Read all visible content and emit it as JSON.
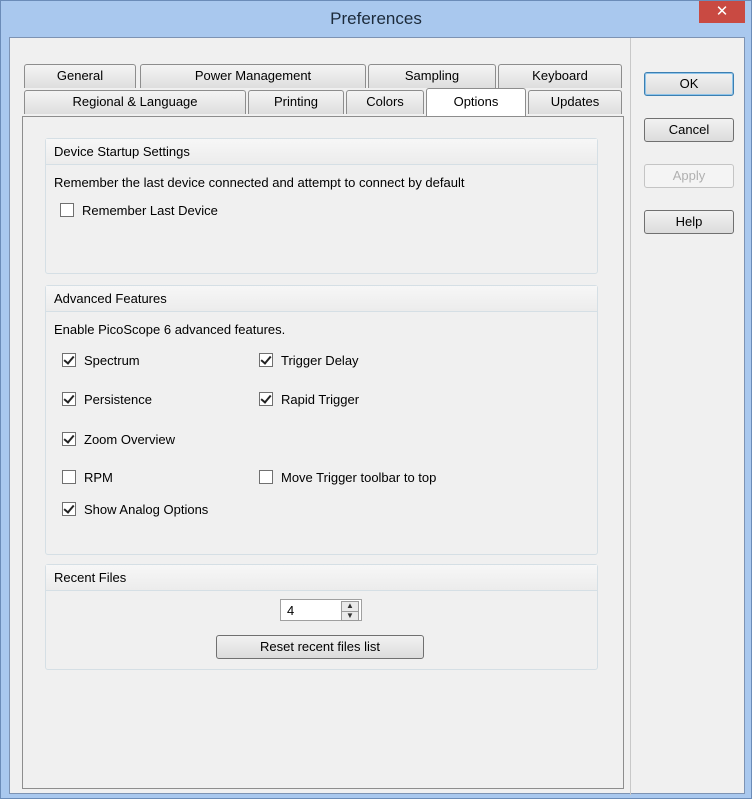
{
  "window": {
    "title": "Preferences",
    "close_label": "✕"
  },
  "tabs": {
    "row1": [
      "General",
      "Power Management",
      "Sampling",
      "Keyboard"
    ],
    "row2": [
      "Regional & Language",
      "Printing",
      "Colors",
      "Options",
      "Updates"
    ],
    "active": "Options"
  },
  "device_startup": {
    "header": "Device Startup Settings",
    "description": "Remember the last device connected and attempt to connect by default",
    "remember_last_device": {
      "label": "Remember Last Device",
      "checked": false
    }
  },
  "advanced": {
    "header": "Advanced Features",
    "description": "Enable PicoScope 6 advanced features.",
    "options": {
      "spectrum": {
        "label": "Spectrum",
        "checked": true
      },
      "trigger_delay": {
        "label": "Trigger Delay",
        "checked": true
      },
      "persistence": {
        "label": "Persistence",
        "checked": true
      },
      "rapid_trigger": {
        "label": "Rapid Trigger",
        "checked": true
      },
      "zoom_overview": {
        "label": "Zoom Overview",
        "checked": true
      },
      "rpm": {
        "label": "RPM",
        "checked": false
      },
      "move_trigger_toolbar": {
        "label": "Move Trigger toolbar to top",
        "checked": false
      },
      "show_analog_options": {
        "label": "Show Analog Options",
        "checked": true
      }
    }
  },
  "recent_files": {
    "header": "Recent Files",
    "count": "4",
    "reset_label": "Reset recent files list"
  },
  "buttons": {
    "ok": "OK",
    "cancel": "Cancel",
    "apply": "Apply",
    "help": "Help"
  },
  "colors": {
    "title_bar": "#a9c8ee",
    "close_button": "#c94a42",
    "dialog_bg": "#f0f0f0"
  }
}
